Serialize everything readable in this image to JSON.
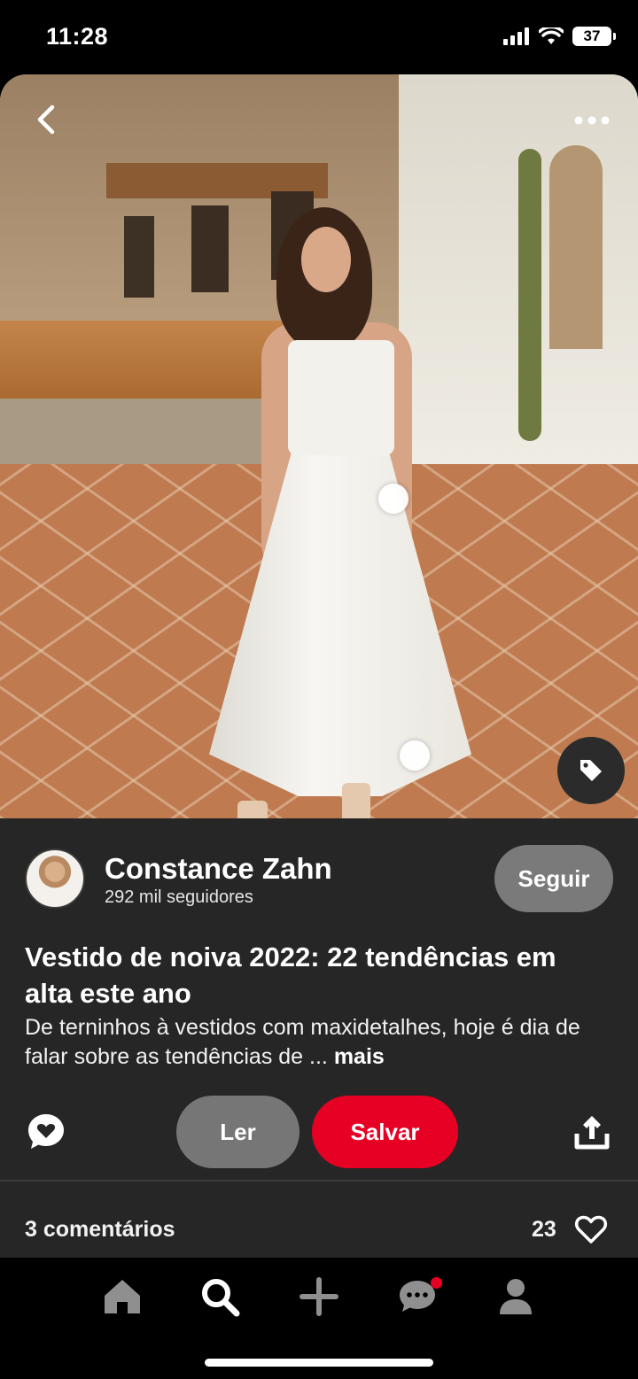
{
  "status_bar": {
    "time": "11:28",
    "battery": "37",
    "icons": [
      "signal-icon",
      "wifi-icon",
      "battery-icon"
    ]
  },
  "pin": {
    "image_description_icons": [
      "back-arrow-icon",
      "more-options-icon",
      "shopping-tag-icon"
    ],
    "author": {
      "name": "Constance Zahn",
      "followers": "292 mil seguidores",
      "follow_label": "Seguir"
    },
    "title": "Vestido de noiva 2022: 22 tendências em alta este ano",
    "description": "De terninhos à vestidos com maxidetalhes, hoje é dia de falar sobre as tendências de ...",
    "more_label": "mais",
    "actions": {
      "read_label": "Ler",
      "save_label": "Salvar"
    },
    "comments_label": "3 comentários",
    "likes": "23"
  },
  "bottom_nav": {
    "items": [
      "home-icon",
      "search-icon",
      "create-icon",
      "messages-icon",
      "profile-icon"
    ],
    "active": "search"
  },
  "colors": {
    "save_red": "#e60023",
    "panel_bg": "#262626",
    "gray_button": "#767676"
  }
}
